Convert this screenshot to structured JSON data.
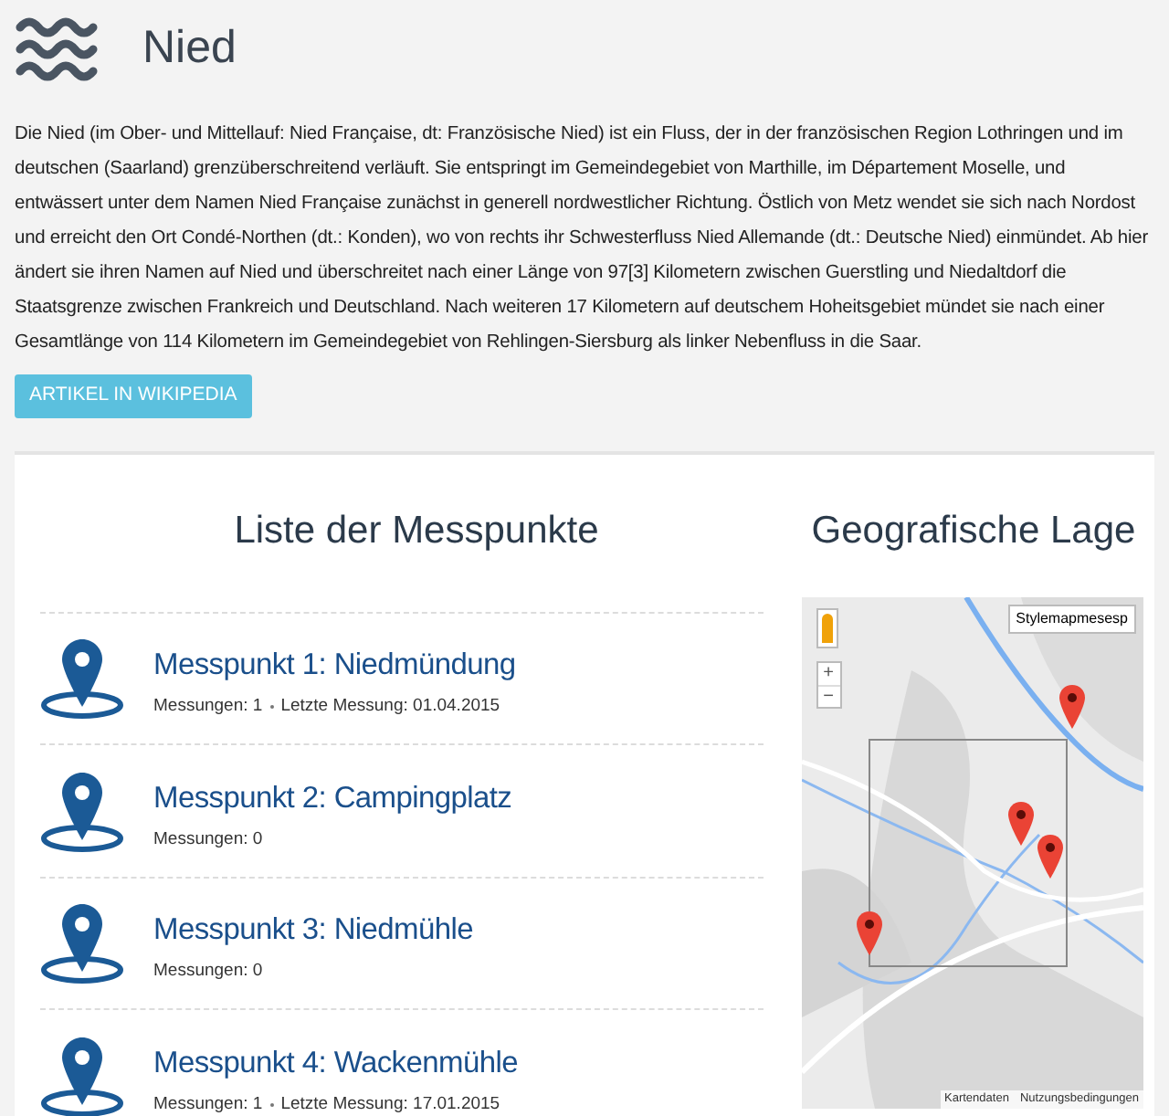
{
  "header": {
    "title": "Nied"
  },
  "description": "Die Nied (im Ober- und Mittellauf: Nied Française, dt: Französische Nied) ist ein Fluss, der in der französischen Region Lothringen und im deutschen (Saarland) grenzüberschreitend verläuft. Sie entspringt im Gemeindegebiet von Marthille, im Département Moselle, und entwässert unter dem Namen Nied Française zunächst in generell nordwestlicher Richtung. Östlich von Metz wendet sie sich nach Nordost und erreicht den Ort Condé-Northen (dt.: Konden), wo von rechts ihr Schwesterfluss Nied Allemande (dt.: Deutsche Nied) einmündet. Ab hier ändert sie ihren Namen auf Nied und überschreitet nach einer Länge von 97[3] Kilometern zwischen Guerstling und Niedaltdorf die Staatsgrenze zwischen Frankreich und Deutschland. Nach weiteren 17 Kilometern auf deutschem Hoheitsgebiet mündet sie nach einer Gesamtlänge von 114 Kilometern im Gemeindegebiet von Rehlingen-Siersburg als linker Nebenfluss in die Saar.",
  "wiki_button": "ARTIKEL IN WIKIPEDIA",
  "list": {
    "title": "Liste der Messpunkte",
    "items": [
      {
        "name": "Messpunkt 1: Niedmündung",
        "count": "Messungen: 1",
        "last": "Letzte Messung: 01.04.2015"
      },
      {
        "name": "Messpunkt 2: Campingplatz",
        "count": "Messungen: 0"
      },
      {
        "name": "Messpunkt 3: Niedmühle",
        "count": "Messungen: 0"
      },
      {
        "name": "Messpunkt 4: Wackenmühle",
        "count": "Messungen: 1",
        "last": "Letzte Messung: 17.01.2015"
      }
    ]
  },
  "map": {
    "title": "Geografische Lage",
    "layer_button": "Stylemapmesesp",
    "zoom_in": "+",
    "zoom_out": "−",
    "footer": [
      "Kartendaten",
      "Nutzungsbedingungen"
    ]
  }
}
